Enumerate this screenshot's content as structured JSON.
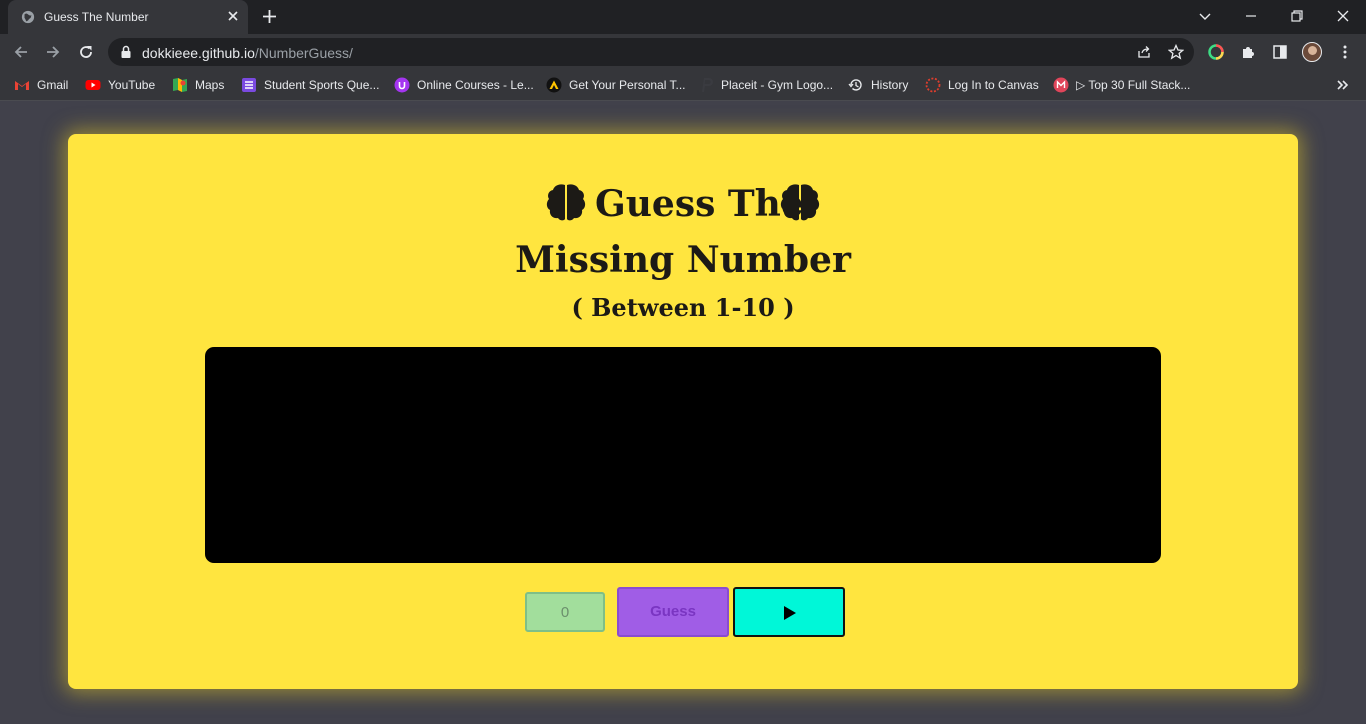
{
  "browser": {
    "tab_title": "Guess The Number",
    "url_host": "dokkieee.github.io",
    "url_path": "/NumberGuess/",
    "bookmarks": [
      {
        "label": "Gmail",
        "icon": "gmail-icon"
      },
      {
        "label": "YouTube",
        "icon": "youtube-icon"
      },
      {
        "label": "Maps",
        "icon": "maps-icon"
      },
      {
        "label": "Student Sports Que...",
        "icon": "list-icon"
      },
      {
        "label": "Online Courses - Le...",
        "icon": "udemy-icon"
      },
      {
        "label": "Get Your Personal T...",
        "icon": "a-logo-icon"
      },
      {
        "label": "Placeit - Gym Logo...",
        "icon": "placeit-icon"
      },
      {
        "label": "History",
        "icon": "history-icon"
      },
      {
        "label": "Log In to Canvas",
        "icon": "canvas-icon"
      },
      {
        "label": "▷ Top 30 Full Stack...",
        "icon": "bookmark-icon"
      }
    ]
  },
  "game": {
    "title_line1": "Guess The",
    "title_line2": "Missing Number",
    "subtitle": "( Between 1-10 )",
    "guess_input_value": "0",
    "guess_button_label": "Guess",
    "play_button_icon": "play-icon",
    "emoji_icon": "brain-icon"
  },
  "colors": {
    "card": "#ffe53f",
    "background": "#41414b",
    "screen": "#000000",
    "input": "#a2de9c",
    "guess_button": "#a05de6",
    "play_button": "#00f7d8"
  }
}
